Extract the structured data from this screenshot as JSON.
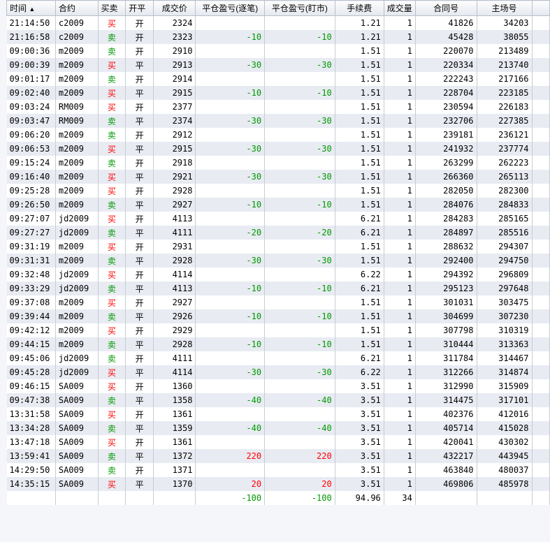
{
  "headers": {
    "time": "时间",
    "sort_arrow": "▲",
    "contract": "合约",
    "side": "买卖",
    "open_close": "开平",
    "price": "成交价",
    "pnl_net": "平仓盈亏(逐笔)",
    "pnl_mtm": "平仓盈亏(盯市)",
    "fee": "手续费",
    "volume": "成交量",
    "order_no": "合同号",
    "trade_no": "主场号"
  },
  "side_labels": {
    "buy": "买",
    "sell": "卖"
  },
  "oc_labels": {
    "open": "开",
    "close": "平"
  },
  "colors": {
    "buy": "#ff0000",
    "sell": "#009900",
    "loss": "#009900",
    "profit": "#ff0000"
  },
  "rows": [
    {
      "time": "21:14:50",
      "contract": "c2009",
      "side": "买",
      "oc": "开",
      "price": "2324",
      "pnl1": "",
      "pnl2": "",
      "fee": "1.21",
      "vol": "1",
      "order": "41826",
      "trade": "34203"
    },
    {
      "time": "21:16:58",
      "contract": "c2009",
      "side": "卖",
      "oc": "开",
      "price": "2323",
      "pnl1": "-10",
      "pnl2": "-10",
      "fee": "1.21",
      "vol": "1",
      "order": "45428",
      "trade": "38055"
    },
    {
      "time": "09:00:36",
      "contract": "m2009",
      "side": "卖",
      "oc": "开",
      "price": "2910",
      "pnl1": "",
      "pnl2": "",
      "fee": "1.51",
      "vol": "1",
      "order": "220070",
      "trade": "213489"
    },
    {
      "time": "09:00:39",
      "contract": "m2009",
      "side": "买",
      "oc": "平",
      "price": "2913",
      "pnl1": "-30",
      "pnl2": "-30",
      "fee": "1.51",
      "vol": "1",
      "order": "220334",
      "trade": "213740"
    },
    {
      "time": "09:01:17",
      "contract": "m2009",
      "side": "卖",
      "oc": "开",
      "price": "2914",
      "pnl1": "",
      "pnl2": "",
      "fee": "1.51",
      "vol": "1",
      "order": "222243",
      "trade": "217166"
    },
    {
      "time": "09:02:40",
      "contract": "m2009",
      "side": "买",
      "oc": "平",
      "price": "2915",
      "pnl1": "-10",
      "pnl2": "-10",
      "fee": "1.51",
      "vol": "1",
      "order": "228704",
      "trade": "223185"
    },
    {
      "time": "09:03:24",
      "contract": "RM009",
      "side": "买",
      "oc": "开",
      "price": "2377",
      "pnl1": "",
      "pnl2": "",
      "fee": "1.51",
      "vol": "1",
      "order": "230594",
      "trade": "226183"
    },
    {
      "time": "09:03:47",
      "contract": "RM009",
      "side": "卖",
      "oc": "平",
      "price": "2374",
      "pnl1": "-30",
      "pnl2": "-30",
      "fee": "1.51",
      "vol": "1",
      "order": "232706",
      "trade": "227385"
    },
    {
      "time": "09:06:20",
      "contract": "m2009",
      "side": "卖",
      "oc": "开",
      "price": "2912",
      "pnl1": "",
      "pnl2": "",
      "fee": "1.51",
      "vol": "1",
      "order": "239181",
      "trade": "236121"
    },
    {
      "time": "09:06:53",
      "contract": "m2009",
      "side": "买",
      "oc": "平",
      "price": "2915",
      "pnl1": "-30",
      "pnl2": "-30",
      "fee": "1.51",
      "vol": "1",
      "order": "241932",
      "trade": "237774"
    },
    {
      "time": "09:15:24",
      "contract": "m2009",
      "side": "卖",
      "oc": "开",
      "price": "2918",
      "pnl1": "",
      "pnl2": "",
      "fee": "1.51",
      "vol": "1",
      "order": "263299",
      "trade": "262223"
    },
    {
      "time": "09:16:40",
      "contract": "m2009",
      "side": "买",
      "oc": "平",
      "price": "2921",
      "pnl1": "-30",
      "pnl2": "-30",
      "fee": "1.51",
      "vol": "1",
      "order": "266360",
      "trade": "265113"
    },
    {
      "time": "09:25:28",
      "contract": "m2009",
      "side": "买",
      "oc": "开",
      "price": "2928",
      "pnl1": "",
      "pnl2": "",
      "fee": "1.51",
      "vol": "1",
      "order": "282050",
      "trade": "282300"
    },
    {
      "time": "09:26:50",
      "contract": "m2009",
      "side": "卖",
      "oc": "平",
      "price": "2927",
      "pnl1": "-10",
      "pnl2": "-10",
      "fee": "1.51",
      "vol": "1",
      "order": "284076",
      "trade": "284833"
    },
    {
      "time": "09:27:07",
      "contract": "jd2009",
      "side": "买",
      "oc": "开",
      "price": "4113",
      "pnl1": "",
      "pnl2": "",
      "fee": "6.21",
      "vol": "1",
      "order": "284283",
      "trade": "285165"
    },
    {
      "time": "09:27:27",
      "contract": "jd2009",
      "side": "卖",
      "oc": "平",
      "price": "4111",
      "pnl1": "-20",
      "pnl2": "-20",
      "fee": "6.21",
      "vol": "1",
      "order": "284897",
      "trade": "285516"
    },
    {
      "time": "09:31:19",
      "contract": "m2009",
      "side": "买",
      "oc": "开",
      "price": "2931",
      "pnl1": "",
      "pnl2": "",
      "fee": "1.51",
      "vol": "1",
      "order": "288632",
      "trade": "294307"
    },
    {
      "time": "09:31:31",
      "contract": "m2009",
      "side": "卖",
      "oc": "平",
      "price": "2928",
      "pnl1": "-30",
      "pnl2": "-30",
      "fee": "1.51",
      "vol": "1",
      "order": "292400",
      "trade": "294750"
    },
    {
      "time": "09:32:48",
      "contract": "jd2009",
      "side": "买",
      "oc": "开",
      "price": "4114",
      "pnl1": "",
      "pnl2": "",
      "fee": "6.22",
      "vol": "1",
      "order": "294392",
      "trade": "296809"
    },
    {
      "time": "09:33:29",
      "contract": "jd2009",
      "side": "卖",
      "oc": "平",
      "price": "4113",
      "pnl1": "-10",
      "pnl2": "-10",
      "fee": "6.21",
      "vol": "1",
      "order": "295123",
      "trade": "297648"
    },
    {
      "time": "09:37:08",
      "contract": "m2009",
      "side": "买",
      "oc": "开",
      "price": "2927",
      "pnl1": "",
      "pnl2": "",
      "fee": "1.51",
      "vol": "1",
      "order": "301031",
      "trade": "303475"
    },
    {
      "time": "09:39:44",
      "contract": "m2009",
      "side": "卖",
      "oc": "平",
      "price": "2926",
      "pnl1": "-10",
      "pnl2": "-10",
      "fee": "1.51",
      "vol": "1",
      "order": "304699",
      "trade": "307230"
    },
    {
      "time": "09:42:12",
      "contract": "m2009",
      "side": "买",
      "oc": "开",
      "price": "2929",
      "pnl1": "",
      "pnl2": "",
      "fee": "1.51",
      "vol": "1",
      "order": "307798",
      "trade": "310319"
    },
    {
      "time": "09:44:15",
      "contract": "m2009",
      "side": "卖",
      "oc": "平",
      "price": "2928",
      "pnl1": "-10",
      "pnl2": "-10",
      "fee": "1.51",
      "vol": "1",
      "order": "310444",
      "trade": "313363"
    },
    {
      "time": "09:45:06",
      "contract": "jd2009",
      "side": "卖",
      "oc": "开",
      "price": "4111",
      "pnl1": "",
      "pnl2": "",
      "fee": "6.21",
      "vol": "1",
      "order": "311784",
      "trade": "314467"
    },
    {
      "time": "09:45:28",
      "contract": "jd2009",
      "side": "买",
      "oc": "平",
      "price": "4114",
      "pnl1": "-30",
      "pnl2": "-30",
      "fee": "6.22",
      "vol": "1",
      "order": "312266",
      "trade": "314874"
    },
    {
      "time": "09:46:15",
      "contract": "SA009",
      "side": "买",
      "oc": "开",
      "price": "1360",
      "pnl1": "",
      "pnl2": "",
      "fee": "3.51",
      "vol": "1",
      "order": "312990",
      "trade": "315909"
    },
    {
      "time": "09:47:38",
      "contract": "SA009",
      "side": "卖",
      "oc": "平",
      "price": "1358",
      "pnl1": "-40",
      "pnl2": "-40",
      "fee": "3.51",
      "vol": "1",
      "order": "314475",
      "trade": "317101"
    },
    {
      "time": "13:31:58",
      "contract": "SA009",
      "side": "买",
      "oc": "开",
      "price": "1361",
      "pnl1": "",
      "pnl2": "",
      "fee": "3.51",
      "vol": "1",
      "order": "402376",
      "trade": "412016"
    },
    {
      "time": "13:34:28",
      "contract": "SA009",
      "side": "卖",
      "oc": "平",
      "price": "1359",
      "pnl1": "-40",
      "pnl2": "-40",
      "fee": "3.51",
      "vol": "1",
      "order": "405714",
      "trade": "415028"
    },
    {
      "time": "13:47:18",
      "contract": "SA009",
      "side": "买",
      "oc": "开",
      "price": "1361",
      "pnl1": "",
      "pnl2": "",
      "fee": "3.51",
      "vol": "1",
      "order": "420041",
      "trade": "430302"
    },
    {
      "time": "13:59:41",
      "contract": "SA009",
      "side": "卖",
      "oc": "平",
      "price": "1372",
      "pnl1": "220",
      "pnl2": "220",
      "fee": "3.51",
      "vol": "1",
      "order": "432217",
      "trade": "443945"
    },
    {
      "time": "14:29:50",
      "contract": "SA009",
      "side": "卖",
      "oc": "开",
      "price": "1371",
      "pnl1": "",
      "pnl2": "",
      "fee": "3.51",
      "vol": "1",
      "order": "463840",
      "trade": "480037"
    },
    {
      "time": "14:35:15",
      "contract": "SA009",
      "side": "买",
      "oc": "平",
      "price": "1370",
      "pnl1": "20",
      "pnl2": "20",
      "fee": "3.51",
      "vol": "1",
      "order": "469806",
      "trade": "485978"
    }
  ],
  "totals": {
    "pnl1": "-100",
    "pnl2": "-100",
    "fee": "94.96",
    "vol": "34"
  }
}
